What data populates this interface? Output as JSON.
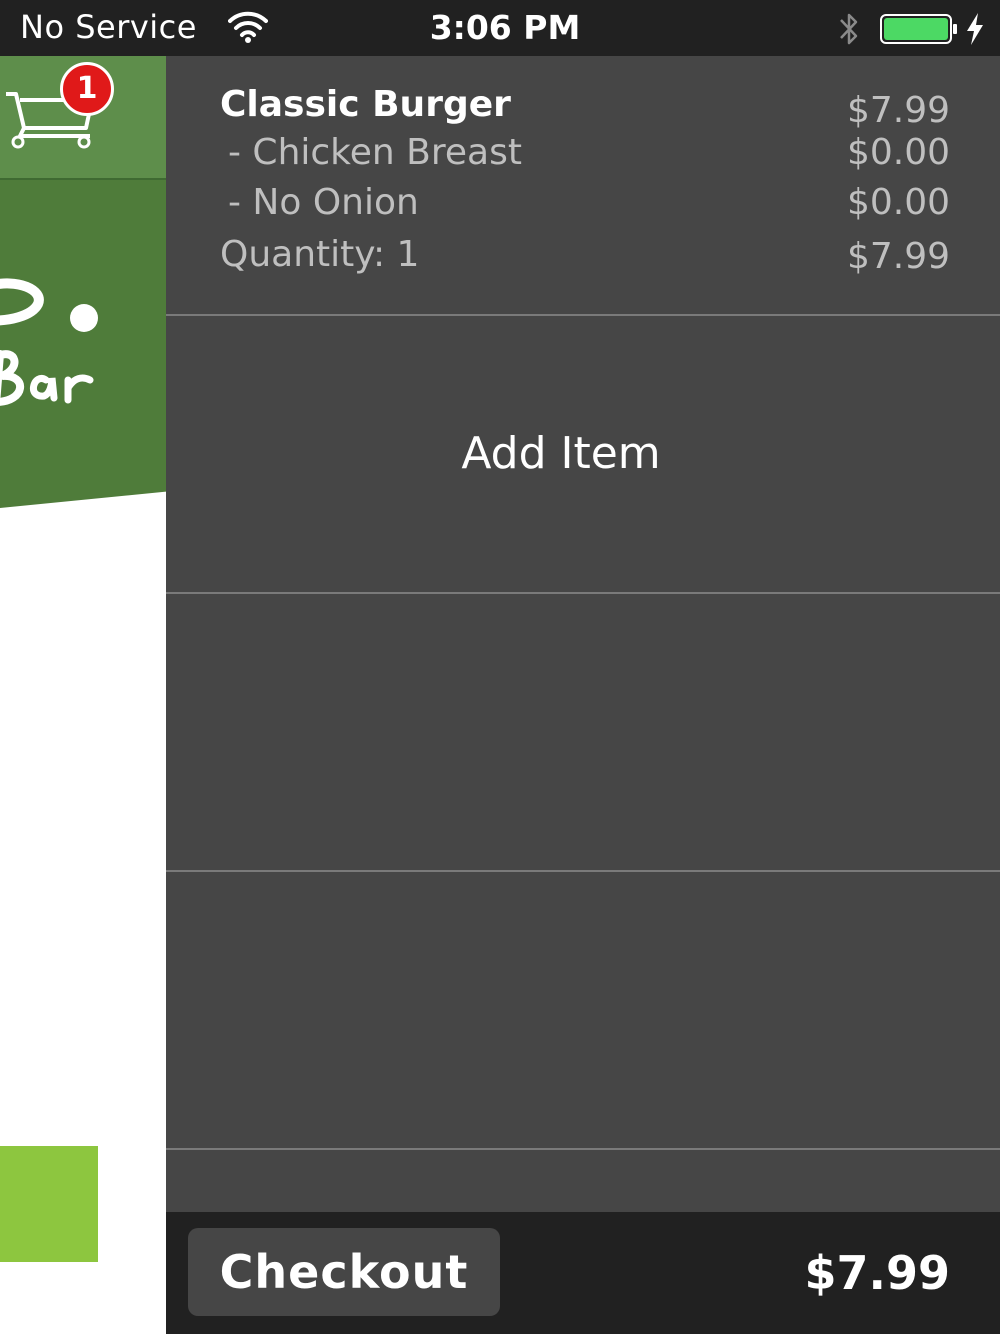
{
  "status_bar": {
    "carrier": "No Service",
    "time": "3:06 PM",
    "battery_color": "#4cd964"
  },
  "background_page": {
    "cart_badge_count": "1",
    "brand_green": "#4f7c3a",
    "accent_green": "#8dc63f"
  },
  "cart": {
    "item": {
      "name": "Classic Burger",
      "price": "$7.99",
      "options": [
        {
          "label": "- Chicken Breast",
          "price": "$0.00"
        },
        {
          "label": "- No Onion",
          "price": "$0.00"
        }
      ],
      "quantity_label": "Quantity: 1",
      "line_total": "$7.99"
    },
    "add_item_label": "Add Item"
  },
  "footer": {
    "checkout_label": "Checkout",
    "total": "$7.99"
  }
}
